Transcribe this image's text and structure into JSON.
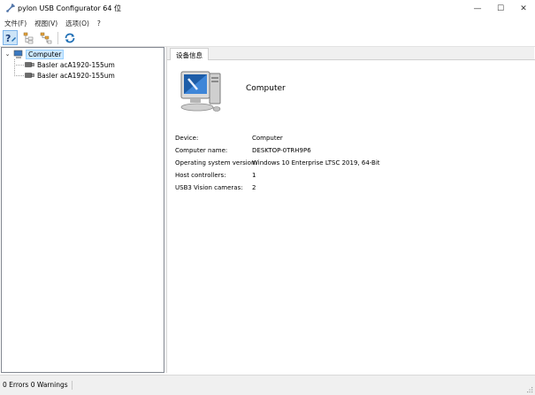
{
  "window": {
    "title": "pylon USB Configurator 64 位",
    "minimize_glyph": "—",
    "maximize_glyph": "☐",
    "close_glyph": "✕"
  },
  "menu": {
    "items": [
      "文件(F)",
      "视图(V)",
      "选项(O)",
      "?"
    ]
  },
  "toolbar": {
    "icons": [
      "help-icon",
      "tree-view-icon",
      "tree-detail-icon",
      "refresh-icon"
    ]
  },
  "tree": {
    "root": {
      "label": "Computer",
      "expander": "⌄"
    },
    "children": [
      {
        "label": "Basler acA1920-155um"
      },
      {
        "label": "Basler acA1920-155um"
      }
    ]
  },
  "tabs": [
    {
      "label": "设备信息"
    }
  ],
  "device_info": {
    "heading": "Computer",
    "rows": [
      {
        "label": "Device:",
        "value": "Computer"
      },
      {
        "label": "Computer name:",
        "value": "DESKTOP-0TRH9P6"
      },
      {
        "label": "Operating system version:",
        "value": "Windows 10 Enterprise LTSC 2019, 64-Bit"
      },
      {
        "label": "Host controllers:",
        "value": "1"
      },
      {
        "label": "USB3 Vision cameras:",
        "value": "2"
      }
    ]
  },
  "status": {
    "text": "0 Errors  0 Warnings"
  },
  "colors": {
    "selection": "#cce8ff",
    "accent": "#1f6fb5"
  }
}
